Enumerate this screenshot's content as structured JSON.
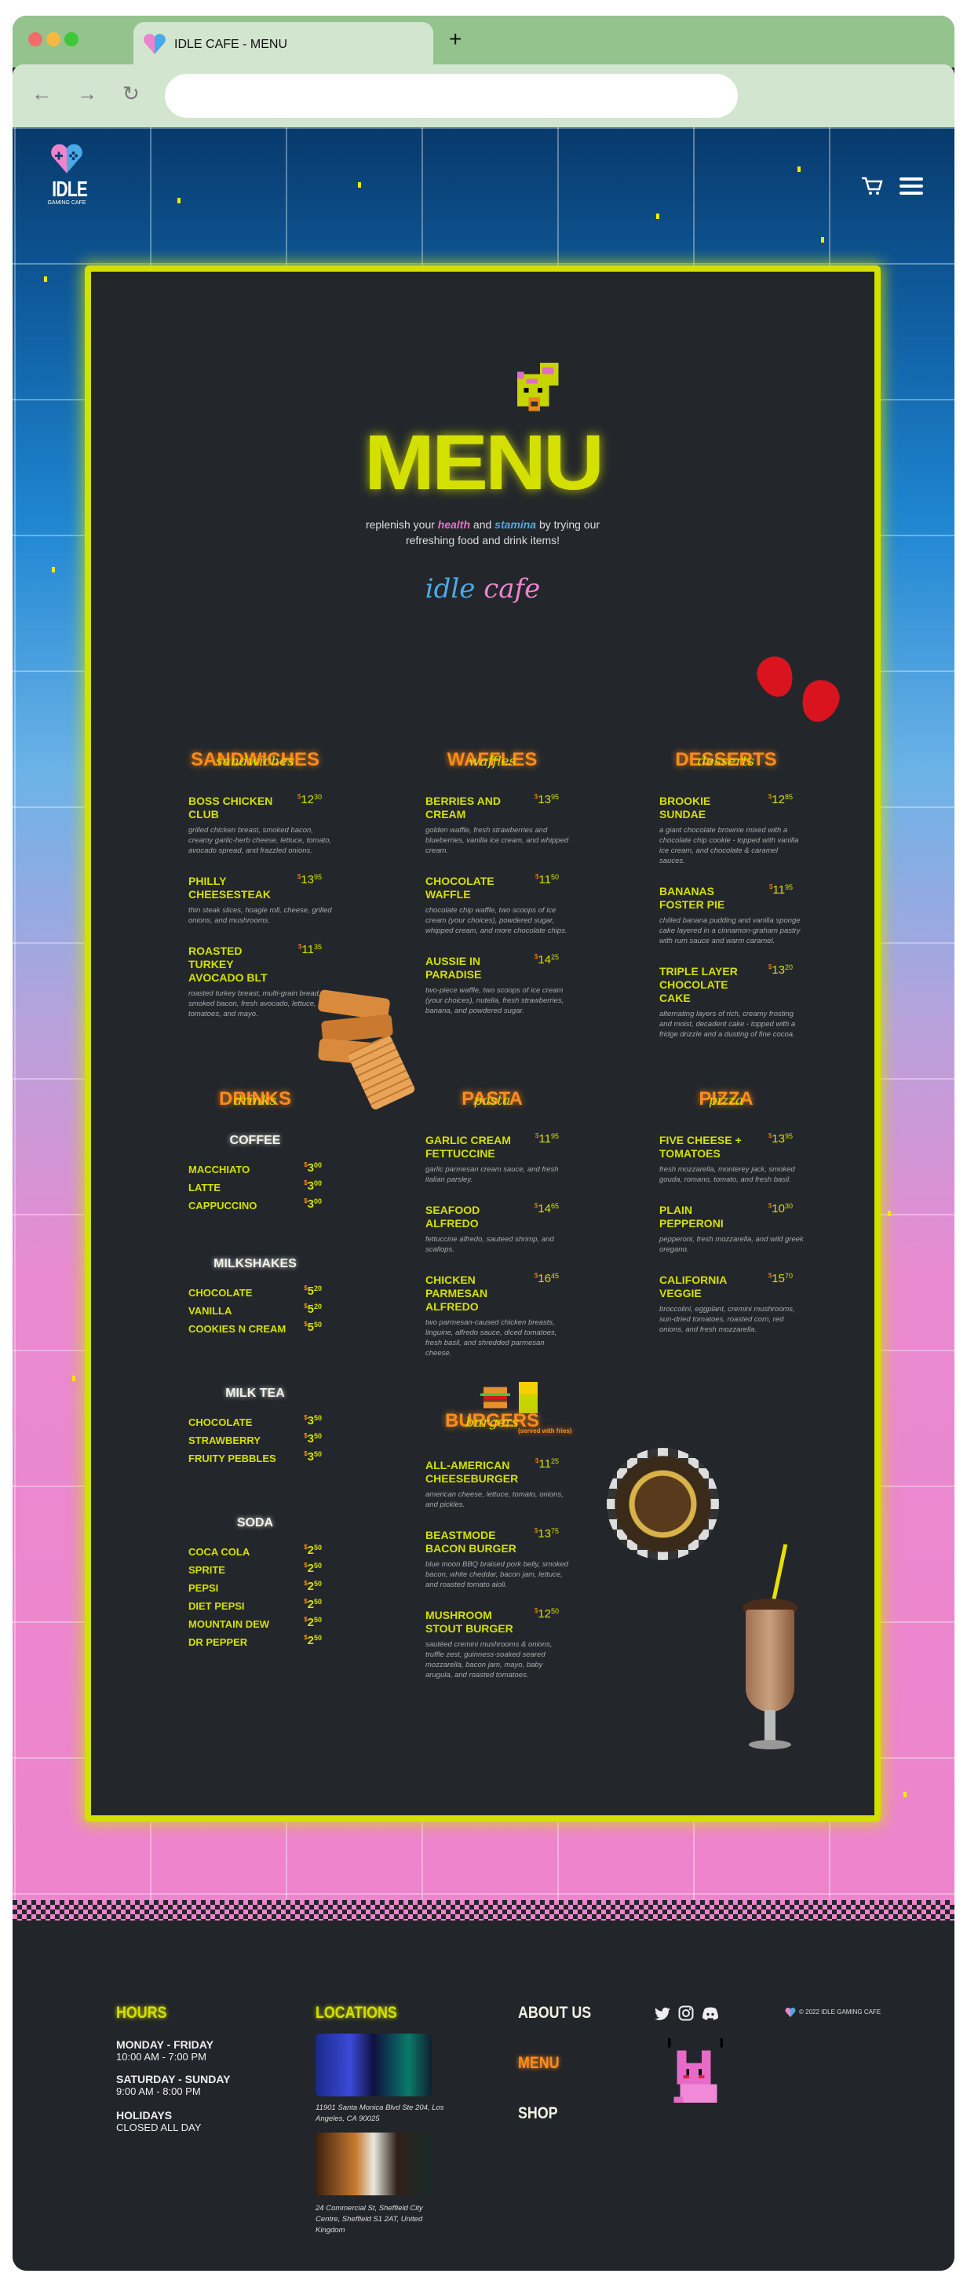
{
  "browser": {
    "tab_title": "IDLE CAFE - MENU",
    "new_tab": "+",
    "back": "←",
    "forward": "→",
    "reload": "↻",
    "url": ""
  },
  "header": {
    "logo_text": "IDLE",
    "logo_sub": "GAMING CAFE",
    "cart_icon": "cart-icon",
    "menu_icon": "hamburger-icon"
  },
  "colors": {
    "accent": "#d4e000",
    "orange": "#ff8c1a",
    "pink": "#ee84cc",
    "blue": "#4aaae8",
    "board": "#23272b"
  },
  "menu": {
    "title": "MENU",
    "subtitle_1": "replenish your ",
    "subtitle_health": "health",
    "subtitle_2": " and ",
    "subtitle_stamina": "stamina",
    "subtitle_3": " by trying our",
    "subtitle_4": "refreshing food and drink items!",
    "logo_idle": "idle",
    "logo_cafe": "cafe"
  },
  "sections": {
    "sandwiches": {
      "title": "SANDWICHES",
      "script": "sandwiches",
      "items": [
        {
          "name": "BOSS CHICKEN CLUB",
          "dollars": "12",
          "cents": "30",
          "desc": "grilled chicken breast, smoked bacon, creamy garlic-herb cheese, lettuce, tomato, avocado spread, and frazzled onions."
        },
        {
          "name": "PHILLY CHEESESTEAK",
          "dollars": "13",
          "cents": "95",
          "desc": "thin steak slices, hoagie roll, cheese, grilled onions, and mushrooms."
        },
        {
          "name": "ROASTED TURKEY AVOCADO BLT",
          "dollars": "11",
          "cents": "35",
          "desc": "roasted turkey breast, multi-grain bread, smoked bacon, fresh avocado, lettuce, tomatoes, and mayo."
        }
      ]
    },
    "waffles": {
      "title": "WAFFLES",
      "script": "waffles",
      "items": [
        {
          "name": "BERRIES AND CREAM",
          "dollars": "13",
          "cents": "95",
          "desc": "golden waffle, fresh strawberries and blueberries, vanilla ice cream, and whipped cream."
        },
        {
          "name": "CHOCOLATE WAFFLE",
          "dollars": "11",
          "cents": "50",
          "desc": "chocolate chip waffle, two scoops of ice cream (your choices), powdered sugar, whipped cream, and more chocolate chips."
        },
        {
          "name": "AUSSIE IN PARADISE",
          "dollars": "14",
          "cents": "25",
          "desc": "two-piece waffle, two scoops of ice cream (your choices), nutella, fresh strawberries, banana, and powdered sugar."
        }
      ]
    },
    "desserts": {
      "title": "DESSERTS",
      "script": "desserts",
      "items": [
        {
          "name": "BROOKIE SUNDAE",
          "dollars": "12",
          "cents": "85",
          "desc": "a giant chocolate brownie mixed with a chocolate chip cookie - topped with vanilla ice cream, and chocolate & caramel sauces."
        },
        {
          "name": "BANANAS FOSTER PIE",
          "dollars": "11",
          "cents": "95",
          "desc": "chilled banana pudding and vanilla sponge cake layered in a cinnamon-graham pastry with rum sauce and warm caramel."
        },
        {
          "name": "TRIPLE LAYER CHOCOLATE CAKE",
          "dollars": "13",
          "cents": "20",
          "desc": "alternating layers of rich, creamy frosting and moist, decadent cake - topped with a fridge drizzle and a dusting of fine cocoa."
        }
      ]
    },
    "pasta": {
      "title": "PASTA",
      "script": "pasta",
      "items": [
        {
          "name": "GARLIC CREAM FETTUCCINE",
          "dollars": "11",
          "cents": "95",
          "desc": "garlic parmesan cream sauce, and fresh italian parsley."
        },
        {
          "name": "SEAFOOD ALFREDO",
          "dollars": "14",
          "cents": "65",
          "desc": "fettuccine alfredo, sauteed shrimp, and scallops."
        },
        {
          "name": "CHICKEN PARMESAN ALFREDO",
          "dollars": "16",
          "cents": "45",
          "desc": "two parmesan-caused chicken breasts, linguine, alfredo sauce, diced tomatoes, fresh basil, and shredded parmesan cheese."
        }
      ]
    },
    "pizza": {
      "title": "PIZZA",
      "script": "pizza",
      "items": [
        {
          "name": "FIVE CHEESE + TOMATOES",
          "dollars": "13",
          "cents": "95",
          "desc": "fresh mozzarella, monterey jack, smoked gouda, romano, tomato, and fresh basil."
        },
        {
          "name": "PLAIN PEPPERONI",
          "dollars": "10",
          "cents": "30",
          "desc": "pepperoni, fresh mozzarella, and wild greek oregano."
        },
        {
          "name": "CALIFORNIA VEGGIE",
          "dollars": "15",
          "cents": "70",
          "desc": "broccolini, eggplant, cremini mushrooms, sun-dried tomatoes, roasted corn, red onions, and fresh mozzarella."
        }
      ]
    },
    "burgers": {
      "title": "BURGERS",
      "script": "burgers",
      "note": "(served with fries)",
      "items": [
        {
          "name": "ALL-AMERICAN CHEESEBURGER",
          "dollars": "11",
          "cents": "25",
          "desc": "american cheese, lettuce, tomato, onions, and pickles."
        },
        {
          "name": "BEASTMODE BACON BURGER",
          "dollars": "13",
          "cents": "75",
          "desc": "blue moon BBQ braised pork belly, smoked bacon, white cheddar, bacon jam, lettuce, and roasted tomato aioli."
        },
        {
          "name": "MUSHROOM STOUT BURGER",
          "dollars": "12",
          "cents": "50",
          "desc": "sautéed cremini mushrooms & onions, truffle zest, guinness-soaked seared mozzarella, bacon jam, mayo, baby arugula, and roasted tomatoes."
        }
      ]
    },
    "drinks": {
      "title": "DRINKS",
      "script": "drinks",
      "groups": [
        {
          "title": "COFFEE",
          "items": [
            {
              "name": "MACCHIATO",
              "dollars": "3",
              "cents": "00"
            },
            {
              "name": "LATTE",
              "dollars": "3",
              "cents": "00"
            },
            {
              "name": "CAPPUCCINO",
              "dollars": "3",
              "cents": "00"
            }
          ]
        },
        {
          "title": "MILKSHAKES",
          "items": [
            {
              "name": "CHOCOLATE",
              "dollars": "5",
              "cents": "20"
            },
            {
              "name": "VANILLA",
              "dollars": "5",
              "cents": "20"
            },
            {
              "name": "COOKIES N CREAM",
              "dollars": "5",
              "cents": "50"
            }
          ]
        },
        {
          "title": "MILK TEA",
          "items": [
            {
              "name": "CHOCOLATE",
              "dollars": "3",
              "cents": "50"
            },
            {
              "name": "STRAWBERRY",
              "dollars": "3",
              "cents": "50"
            },
            {
              "name": "FRUITY PEBBLES",
              "dollars": "3",
              "cents": "50"
            }
          ]
        },
        {
          "title": "SODA",
          "items": [
            {
              "name": "COCA COLA",
              "dollars": "2",
              "cents": "50"
            },
            {
              "name": "SPRITE",
              "dollars": "2",
              "cents": "50"
            },
            {
              "name": "PEPSI",
              "dollars": "2",
              "cents": "50"
            },
            {
              "name": "DIET PEPSI",
              "dollars": "2",
              "cents": "50"
            },
            {
              "name": "MOUNTAIN DEW",
              "dollars": "2",
              "cents": "50"
            },
            {
              "name": "DR PEPPER",
              "dollars": "2",
              "cents": "50"
            }
          ]
        }
      ]
    }
  },
  "footer": {
    "hours_title": "HOURS",
    "hours": [
      {
        "day": "MONDAY - FRIDAY",
        "time": "10:00 AM - 7:00 PM"
      },
      {
        "day": "SATURDAY - SUNDAY",
        "time": "9:00 AM - 8:00 PM"
      },
      {
        "day": "HOLIDAYS",
        "time": "CLOSED ALL DAY"
      }
    ],
    "locations_title": "LOCATIONS",
    "locations": [
      "11901 Santa Monica Blvd Ste 204, Los Angeles, CA 90025",
      "24 Commercial St, Sheffield City Centre, Sheffield S1 2AT, United Kingdom"
    ],
    "links": {
      "about": "ABOUT US",
      "menu": "MENU",
      "shop": "SHOP"
    },
    "social_icons": [
      "twitter-icon",
      "instagram-icon",
      "discord-icon"
    ],
    "copyright": "© 2022 IDLE GAMING CAFE"
  }
}
